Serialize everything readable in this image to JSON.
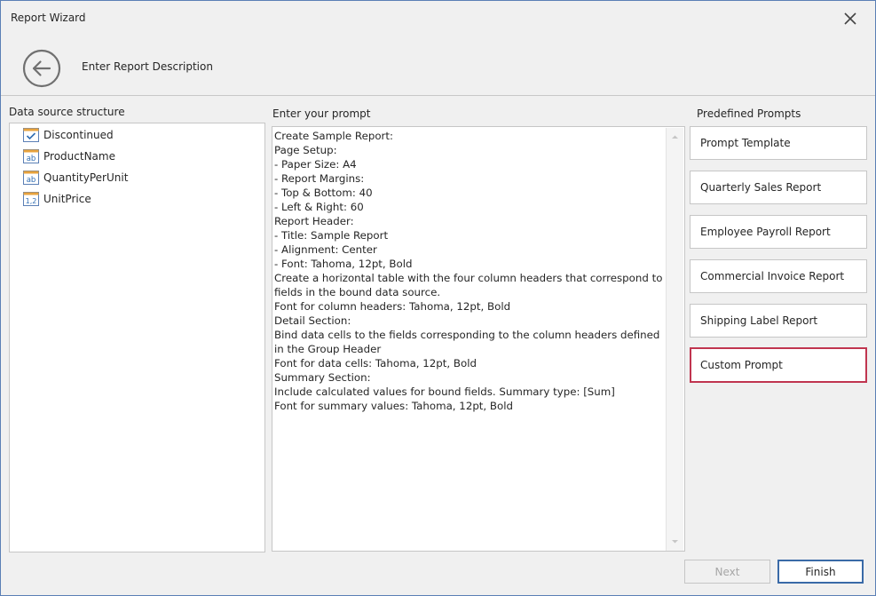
{
  "window": {
    "title": "Report Wizard"
  },
  "header": {
    "step_title": "Enter Report Description"
  },
  "data_source": {
    "label": "Data source structure",
    "fields": [
      {
        "name": "Discontinued",
        "icon": "boolean-field-icon"
      },
      {
        "name": "ProductName",
        "icon": "text-field-icon"
      },
      {
        "name": "QuantityPerUnit",
        "icon": "text-field-icon"
      },
      {
        "name": "UnitPrice",
        "icon": "numeric-field-icon"
      }
    ]
  },
  "prompt": {
    "label": "Enter your prompt",
    "text": "Create Sample Report:\nPage Setup:\n- Paper Size: A4\n- Report Margins:\n- Top & Bottom: 40\n- Left & Right: 60\nReport Header:\n- Title: Sample Report\n- Alignment: Center\n- Font: Tahoma, 12pt, Bold\nCreate a horizontal table with the four column headers that correspond to fields in the bound data source.\nFont for column headers: Tahoma, 12pt, Bold\nDetail Section:\nBind data cells to the fields corresponding to the column headers defined in the Group Header\nFont for data cells: Tahoma, 12pt, Bold\nSummary Section:\nInclude calculated values for bound fields. Summary type: [Sum]\nFont for summary values: Tahoma, 12pt, Bold"
  },
  "predefined": {
    "label": "Predefined Prompts",
    "items": [
      {
        "label": "Prompt Template"
      },
      {
        "label": "Quarterly Sales Report"
      },
      {
        "label": "Employee Payroll Report"
      },
      {
        "label": "Commercial Invoice Report"
      },
      {
        "label": "Shipping Label Report"
      },
      {
        "label": "Custom Prompt"
      }
    ],
    "selected_index": 5,
    "selected_color": "#c0354f"
  },
  "footer": {
    "next_label": "Next",
    "finish_label": "Finish"
  },
  "colors": {
    "accent": "#3a6aa7",
    "field_icon": "#e8a33d"
  }
}
